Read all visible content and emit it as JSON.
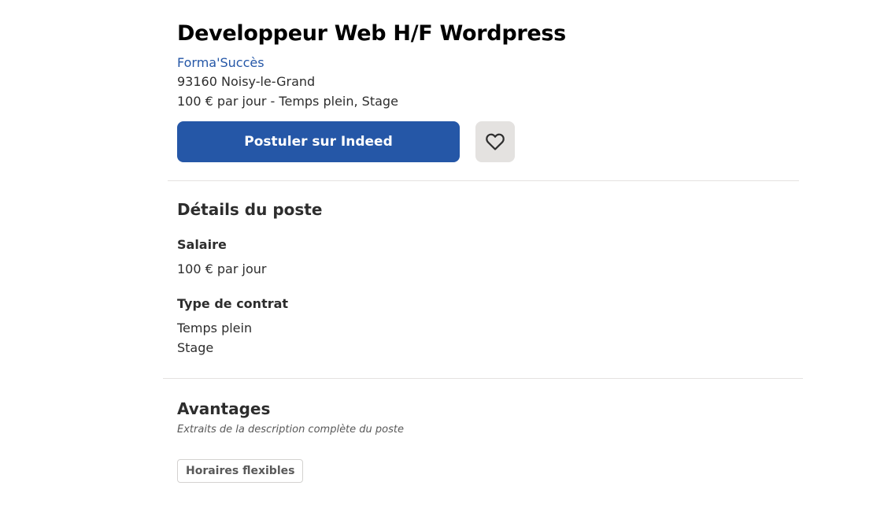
{
  "job": {
    "title": "Developpeur Web H/F Wordpress",
    "company": "Forma'Succès",
    "location": "93160 Noisy-le-Grand",
    "salary_and_type": "100 € par jour  - Temps plein, Stage"
  },
  "actions": {
    "apply_label": "Postuler sur Indeed",
    "save_icon": "heart-icon"
  },
  "details": {
    "title": "Détails du poste",
    "salary_label": "Salaire",
    "salary_value": "100 € par jour",
    "contract_label": "Type de contrat",
    "contract_values": [
      "Temps plein",
      "Stage"
    ]
  },
  "benefits": {
    "title": "Avantages",
    "subtitle": "Extraits de la description complète du poste",
    "tags": [
      "Horaires flexibles"
    ]
  },
  "colors": {
    "accent": "#2557a7",
    "divider": "#e4e2e0",
    "save_bg": "#e4e2e0"
  }
}
